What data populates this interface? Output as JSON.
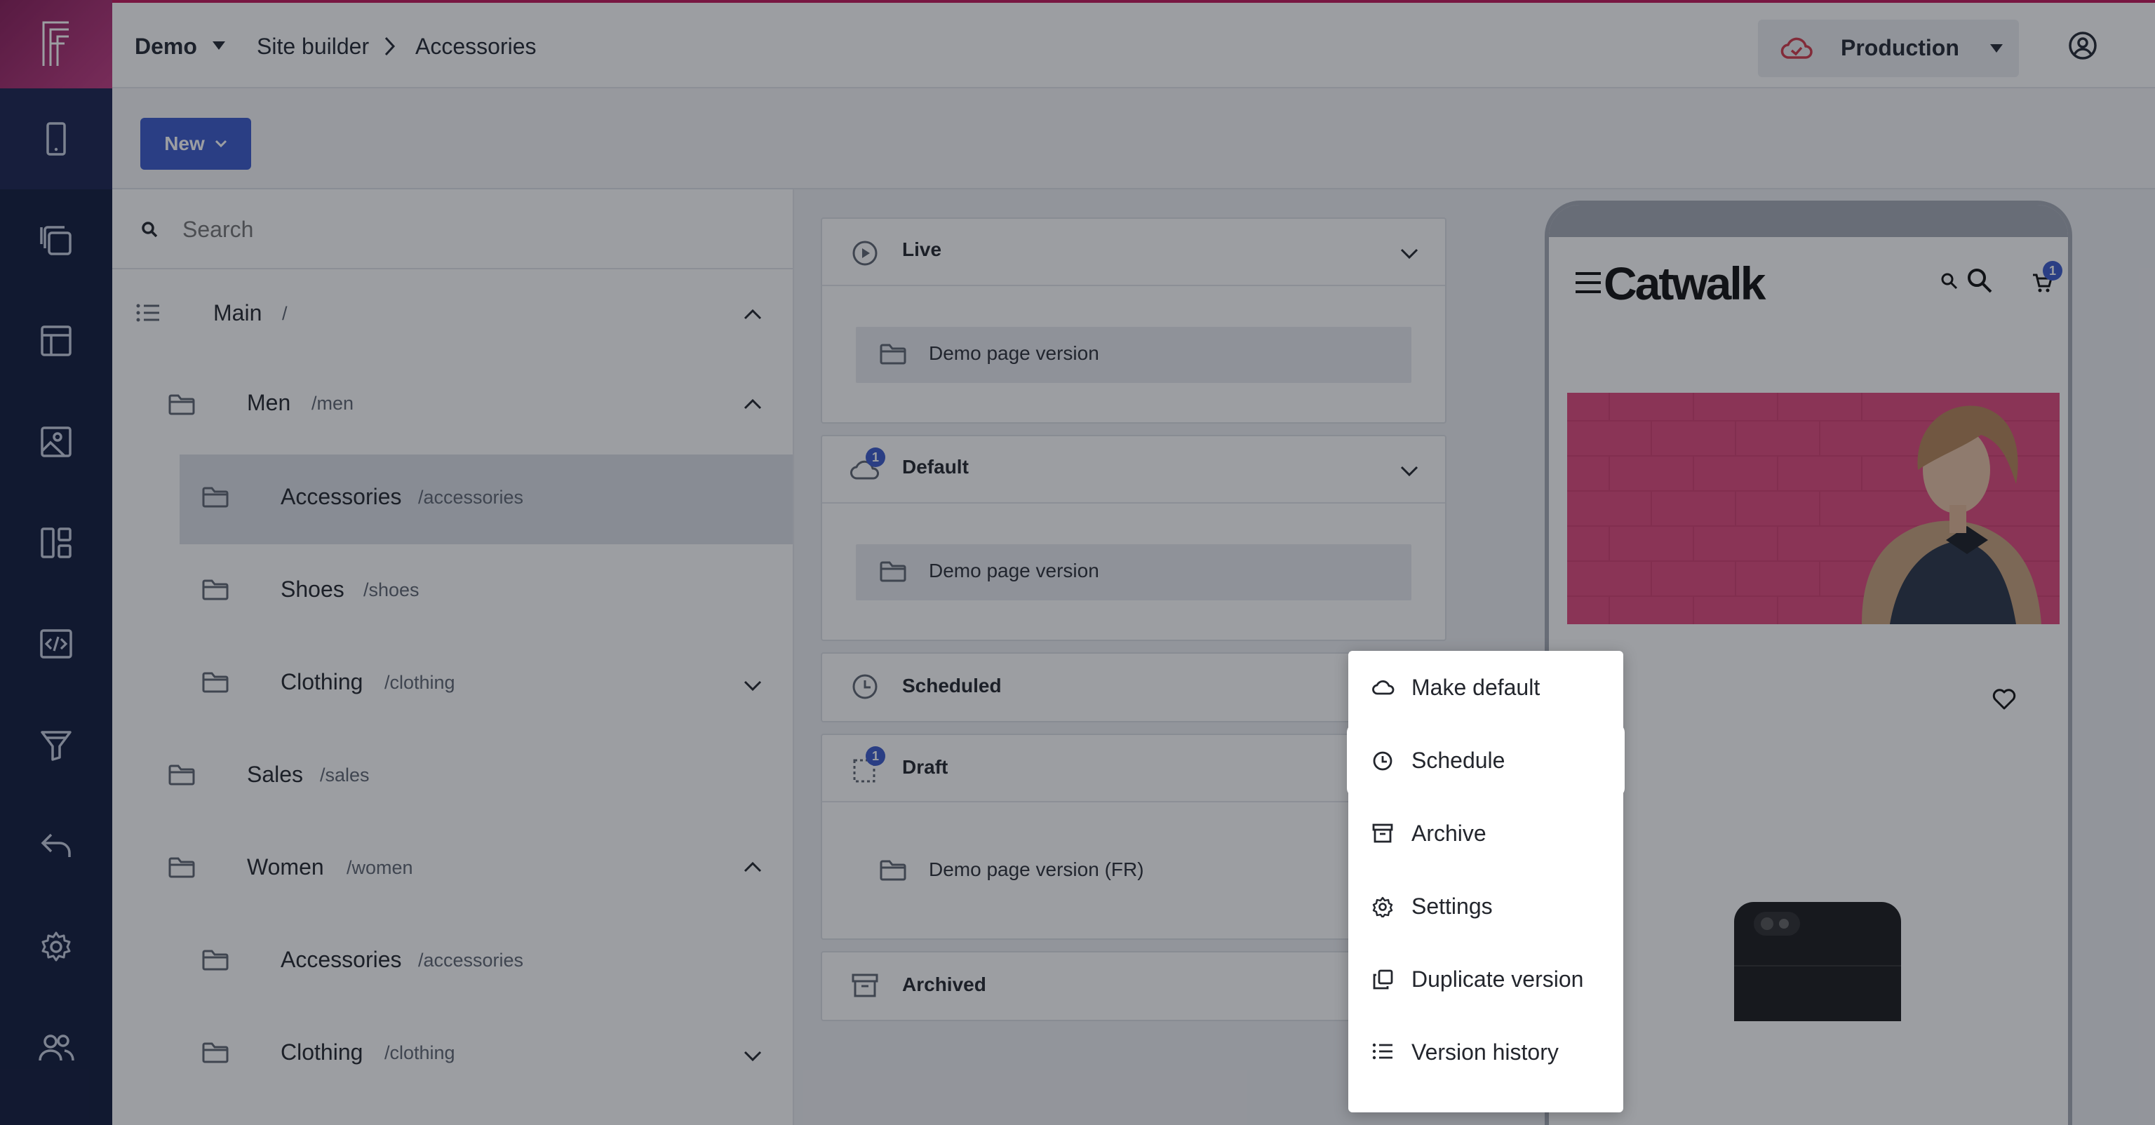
{
  "colors": {
    "nav_bg": "#111a3b",
    "logo_gradient_start": "#8a1d5a",
    "logo_gradient_end": "#c03b82",
    "accent_blue": "#3b5bcb",
    "environment_cloud": "#d33a4a",
    "hero_pink": "#e0497c"
  },
  "app": {
    "logo_icon": "f-logo-icon",
    "nav_icons": [
      "device-mobile-icon",
      "copy-pages-icon",
      "layout-icon",
      "image-icon",
      "dashboard-icon",
      "code-icon",
      "funnel-icon",
      "undo-icon",
      "gear-icon",
      "users-icon"
    ]
  },
  "topbar": {
    "project": "Demo",
    "breadcrumb": [
      "Site builder",
      "Accessories"
    ],
    "environment": "Production",
    "account_icon": "user-circle-icon"
  },
  "toolbar": {
    "new_label": "New"
  },
  "tree": {
    "search_placeholder": "Search",
    "root": {
      "label": "Main",
      "path": "/"
    },
    "nodes": [
      {
        "label": "Men",
        "path": "/men",
        "expanded": true
      },
      {
        "label": "Accessories",
        "path": "/accessories",
        "selected": true
      },
      {
        "label": "Shoes",
        "path": "/shoes"
      },
      {
        "label": "Clothing",
        "path": "/clothing",
        "expanded": false
      },
      {
        "label": "Sales",
        "path": "/sales"
      },
      {
        "label": "Women",
        "path": "/women",
        "expanded": true
      },
      {
        "label": "Accessories",
        "path": "/accessories"
      },
      {
        "label": "Clothing",
        "path": "/clothing",
        "expanded": false
      }
    ]
  },
  "versions": {
    "live": {
      "title": "Live",
      "items": [
        "Demo page version"
      ]
    },
    "default": {
      "title": "Default",
      "badge": "1",
      "items": [
        "Demo page version"
      ]
    },
    "scheduled": {
      "title": "Scheduled"
    },
    "draft": {
      "title": "Draft",
      "badge": "1",
      "items": [
        "Demo page version (FR)"
      ]
    },
    "archived": {
      "title": "Archived"
    }
  },
  "preview": {
    "brand": "Catwalk",
    "cart_count": "1"
  },
  "context_menu": {
    "items": [
      {
        "label": "Make default",
        "icon": "cloud-icon"
      },
      {
        "label": "Schedule",
        "icon": "clock-icon",
        "highlighted": true
      },
      {
        "label": "Archive",
        "icon": "archive-icon"
      },
      {
        "label": "Settings",
        "icon": "gear-icon"
      },
      {
        "label": "Duplicate version",
        "icon": "duplicate-icon"
      },
      {
        "label": "Version history",
        "icon": "list-icon"
      }
    ]
  }
}
